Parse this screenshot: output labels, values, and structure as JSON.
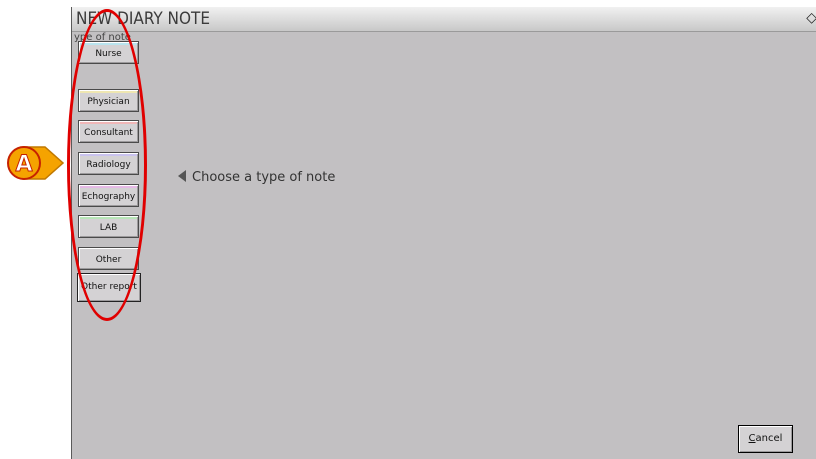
{
  "dialog": {
    "title": "NEW DIARY NOTE",
    "section_label": "ype of note",
    "close_icon": "chevron-left-icon"
  },
  "note_types": [
    {
      "label": "Nurse",
      "color": "#b9e3ee"
    },
    {
      "label": "Physician",
      "color": "#efe7b2"
    },
    {
      "label": "Consultant",
      "color": "#f0b7b7"
    },
    {
      "label": "Radiology",
      "color": "#c9c2ee"
    },
    {
      "label": "Echography",
      "color": "#e6b9e6"
    },
    {
      "label": "LAB",
      "color": "#b7e6b7"
    },
    {
      "label": "Other",
      "color": "#d4d2d4"
    }
  ],
  "other_report_label": "Other report",
  "hint": "Choose a type of note",
  "cancel": {
    "prefix": "C",
    "rest": "ancel"
  },
  "annotation": {
    "marker": "A",
    "ring_color": "#e00000",
    "marker_color": "#f5a300"
  }
}
